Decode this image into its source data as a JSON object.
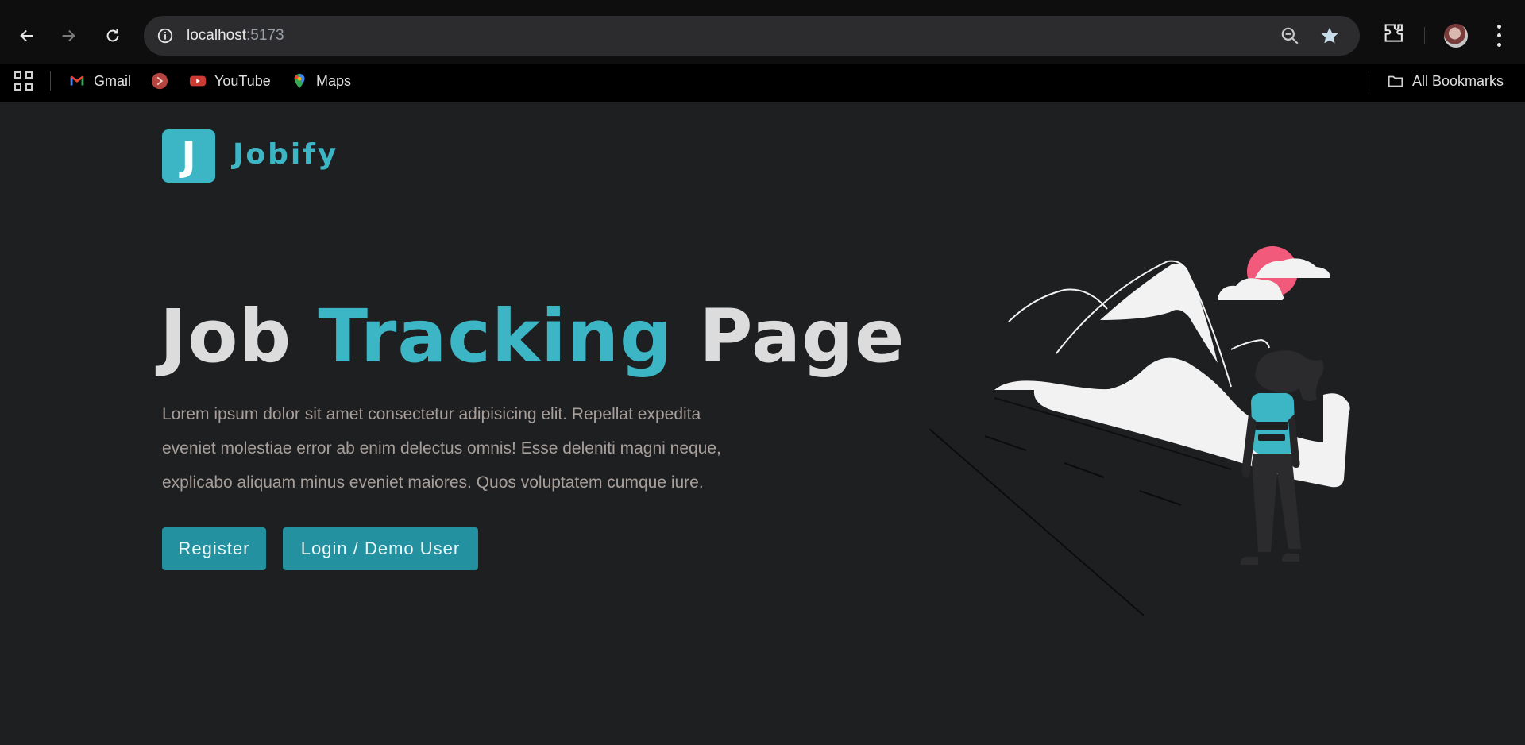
{
  "browser": {
    "url_host": "localhost",
    "url_port": ":5173",
    "bookmarks": [
      {
        "label": "Gmail"
      },
      {
        "label": ""
      },
      {
        "label": "YouTube"
      },
      {
        "label": "Maps"
      }
    ],
    "all_bookmarks_label": "All Bookmarks"
  },
  "page": {
    "logo_letter": "J",
    "logo_text": "Jobify",
    "title_part1": "Job ",
    "title_accent": "Tracking",
    "title_part2": " Page",
    "description": "Lorem ipsum dolor sit amet consectetur adipisicing elit. Repellat expedita eveniet molestiae error ab enim delectus omnis! Esse deleniti magni neque, explicabo aliquam minus eveniet maiores. Quos voluptatem cumque iure.",
    "register_label": "Register",
    "login_label": "Login / Demo User"
  },
  "colors": {
    "accent": "#3cb6c4",
    "button": "#2391a0",
    "background": "#1e1f21",
    "sun": "#f25a7c"
  }
}
